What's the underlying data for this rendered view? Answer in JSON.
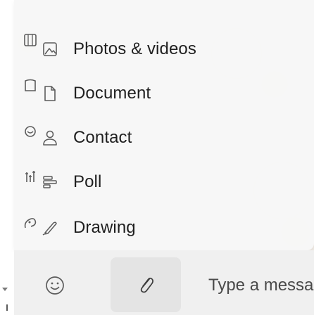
{
  "attach_menu": {
    "items": [
      {
        "label": "Photos & videos",
        "icon": "photo-icon"
      },
      {
        "label": "Document",
        "icon": "document-icon"
      },
      {
        "label": "Contact",
        "icon": "contact-icon"
      },
      {
        "label": "Poll",
        "icon": "poll-icon"
      },
      {
        "label": "Drawing",
        "icon": "drawing-icon"
      }
    ],
    "side_icons": [
      "photo-icon",
      "document-icon",
      "contact-icon",
      "poll-icon",
      "drawing-icon"
    ]
  },
  "compose": {
    "emoji_icon": "emoji-icon",
    "attach_icon": "paperclip-icon",
    "placeholder": "Type a message"
  },
  "colors": {
    "menu_bg": "#f8f8f8",
    "compose_bg": "#f0f0f0",
    "attach_active_bg": "#e4e4e4",
    "text": "#1f1f1f",
    "icon": "#5c5c5c"
  }
}
